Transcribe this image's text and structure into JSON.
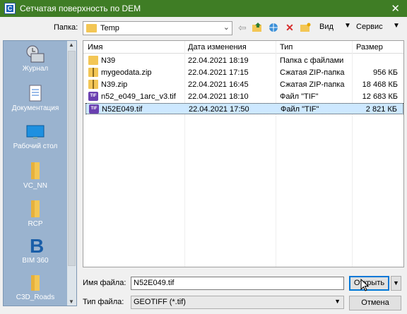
{
  "window": {
    "title": "Сетчатая поверхность по DEM",
    "close": "✕"
  },
  "toolbar": {
    "folder_label": "Папка:",
    "folder_value": "Temp",
    "view_label": "Вид",
    "service_label": "Сервис"
  },
  "places": [
    {
      "label": "Журнал",
      "icon": "history-icon"
    },
    {
      "label": "Документация",
      "icon": "documents-icon"
    },
    {
      "label": "Рабочий стол",
      "icon": "desktop-icon"
    },
    {
      "label": "VC_NN",
      "icon": "folder-icon"
    },
    {
      "label": "RCP",
      "icon": "folder-icon"
    },
    {
      "label": "BIM 360",
      "icon": "bim360-icon"
    },
    {
      "label": "C3D_Roads",
      "icon": "folder-icon"
    }
  ],
  "columns": {
    "name": "Имя",
    "date": "Дата изменения",
    "type": "Тип",
    "size": "Размер"
  },
  "files": [
    {
      "name": "N39",
      "date": "22.04.2021 18:19",
      "type": "Папка с файлами",
      "size": "",
      "icon": "folder"
    },
    {
      "name": "mygeodata.zip",
      "date": "22.04.2021 17:15",
      "type": "Сжатая ZIP-папка",
      "size": "956 КБ",
      "icon": "zip"
    },
    {
      "name": "N39.zip",
      "date": "22.04.2021 16:45",
      "type": "Сжатая ZIP-папка",
      "size": "18 468 КБ",
      "icon": "zip"
    },
    {
      "name": "n52_e049_1arc_v3.tif",
      "date": "22.04.2021 18:10",
      "type": "Файл \"TIF\"",
      "size": "12 683 КБ",
      "icon": "tif"
    },
    {
      "name": "N52E049.tif",
      "date": "22.04.2021 17:50",
      "type": "Файл \"TIF\"",
      "size": "2 821 КБ",
      "icon": "tif",
      "selected": true
    }
  ],
  "footer": {
    "filename_label": "Имя файла:",
    "filename_value": "N52E049.tif",
    "filetype_label": "Тип файла:",
    "filetype_value": "GEOTIFF (*.tif)",
    "open_label": "Открыть",
    "cancel_label": "Отмена"
  }
}
